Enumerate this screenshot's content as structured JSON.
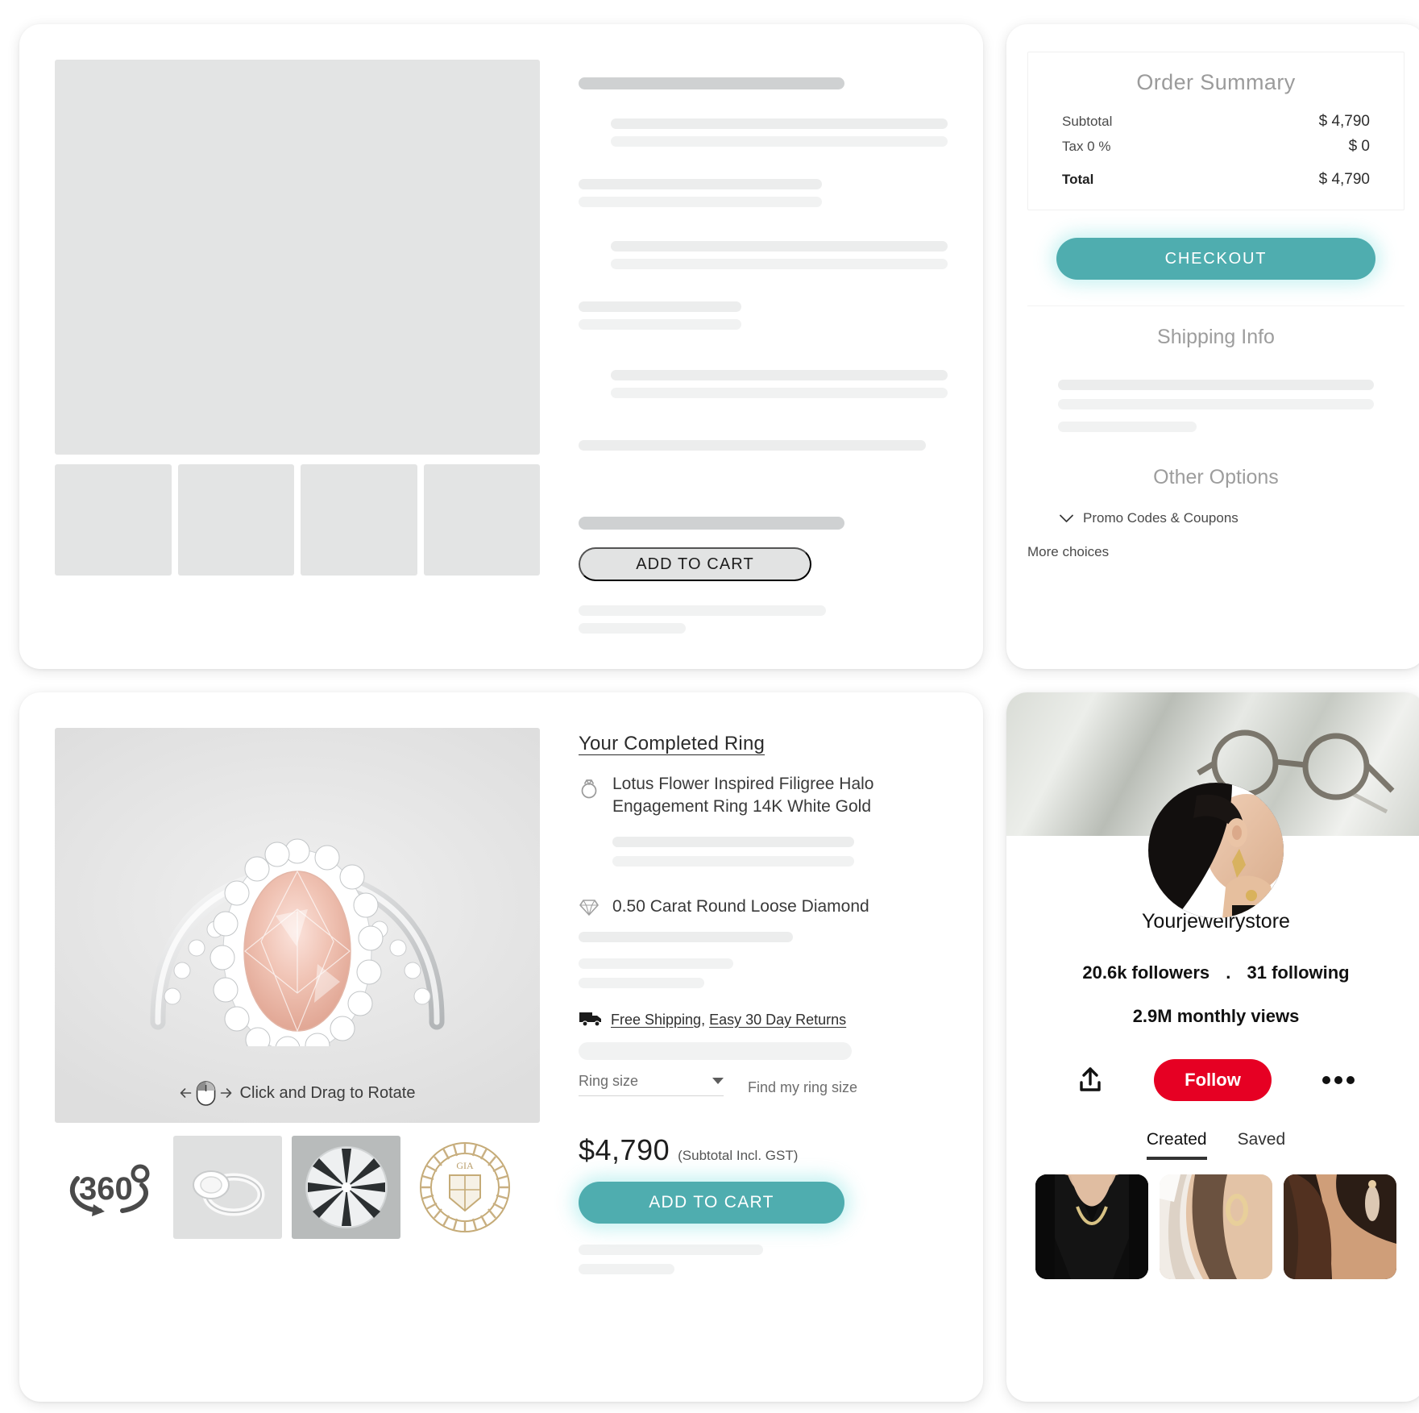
{
  "order_summary": {
    "title": "Order Summary",
    "rows": [
      {
        "label": "Subtotal",
        "value": "$ 4,790"
      },
      {
        "label": "Tax 0 %",
        "value": "$ 0"
      }
    ],
    "total": {
      "label": "Total",
      "value": "$ 4,790"
    },
    "checkout_label": "CHECKOUT",
    "shipping_title": "Shipping Info",
    "other_options_title": "Other Options",
    "promo_label": "Promo Codes & Coupons",
    "promo_chevron": "chevron-down",
    "more_choices_label": "More choices",
    "accent_color": "#4fadaf"
  },
  "skeleton_card": {
    "add_to_cart_label": "ADD TO CART"
  },
  "product": {
    "heading": "Your Completed Ring",
    "ring_name": "Lotus Flower Inspired Filigree Halo Engagement Ring 14K White Gold",
    "diamond_name": "0.50 Carat Round Loose Diamond",
    "shipping_link": "Free Shipping",
    "shipping_separator": ",",
    "returns_link": "Easy 30 Day Returns",
    "ring_size_placeholder": "Ring size",
    "find_size_label": "Find my ring size",
    "price": "$4,790",
    "price_note": "(Subtotal Incl. GST)",
    "add_to_cart_label": "ADD TO CART",
    "rotate_hint": "Click and Drag to Rotate",
    "thumbnails": [
      {
        "name": "360-view-thumbnail",
        "label": "360"
      },
      {
        "name": "ring-side-thumbnail",
        "label": ""
      },
      {
        "name": "diamond-top-thumbnail",
        "label": ""
      },
      {
        "name": "gia-certificate-thumbnail",
        "label": "GIA"
      }
    ],
    "accent_color": "#4fadaf"
  },
  "profile": {
    "name": "Yourjewelrystore",
    "followers": "20.6k followers",
    "separator": ".",
    "following": "31 following",
    "monthly_views": "2.9M monthly views",
    "follow_label": "Follow",
    "share_icon": "share-icon",
    "more_icon": "ellipsis-icon",
    "tabs": [
      {
        "label": "Created",
        "active": true
      },
      {
        "label": "Saved",
        "active": false
      }
    ],
    "pins": [
      {
        "name": "pin-necklace"
      },
      {
        "name": "pin-hoop-earring"
      },
      {
        "name": "pin-drop-earring"
      }
    ],
    "brand_color": "#e60023"
  }
}
